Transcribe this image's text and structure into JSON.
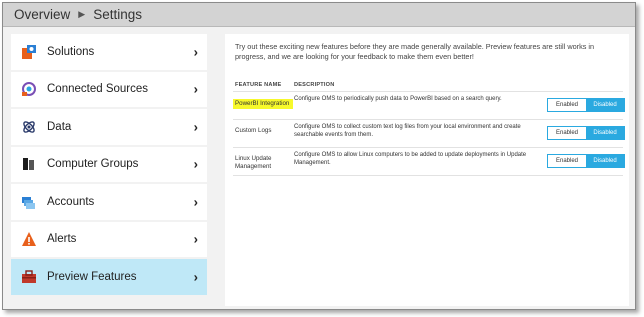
{
  "breadcrumb": {
    "root": "Overview",
    "separator": "▶",
    "current": "Settings"
  },
  "sidebar": {
    "items": [
      {
        "label": "Solutions",
        "icon": "solutions-icon"
      },
      {
        "label": "Connected Sources",
        "icon": "connected-sources-icon"
      },
      {
        "label": "Data",
        "icon": "data-icon"
      },
      {
        "label": "Computer Groups",
        "icon": "computer-groups-icon"
      },
      {
        "label": "Accounts",
        "icon": "accounts-icon"
      },
      {
        "label": "Alerts",
        "icon": "alerts-icon"
      },
      {
        "label": "Preview Features",
        "icon": "preview-features-icon",
        "active": true
      }
    ],
    "chevron": "›"
  },
  "main": {
    "intro": "Try out these exciting new features before they are made generally available. Preview features are still works in progress, and we are looking for your feedback to make them even better!",
    "headers": {
      "name": "FEATURE NAME",
      "description": "DESCRIPTION"
    },
    "features": [
      {
        "name": "PowerBI Integration",
        "description": "Configure OMS to periodically push data to PowerBI based on a search query.",
        "enabled_label": "Enabled",
        "disabled_label": "Disabled",
        "state": "Disabled"
      },
      {
        "name": "Custom Logs",
        "description": "Configure OMS to collect custom text log files from your local environment and create searchable events from them.",
        "enabled_label": "Enabled",
        "disabled_label": "Disabled",
        "state": "Disabled"
      },
      {
        "name": "Linux Update Management",
        "description": "Configure OMS to allow Linux computers to be added to update deployments in Update Management.",
        "enabled_label": "Enabled",
        "disabled_label": "Disabled",
        "state": "Disabled"
      }
    ]
  },
  "colors": {
    "accent": "#2aa9e0",
    "active_nav": "#bfe8f7",
    "highlight": "#f7f92b"
  }
}
